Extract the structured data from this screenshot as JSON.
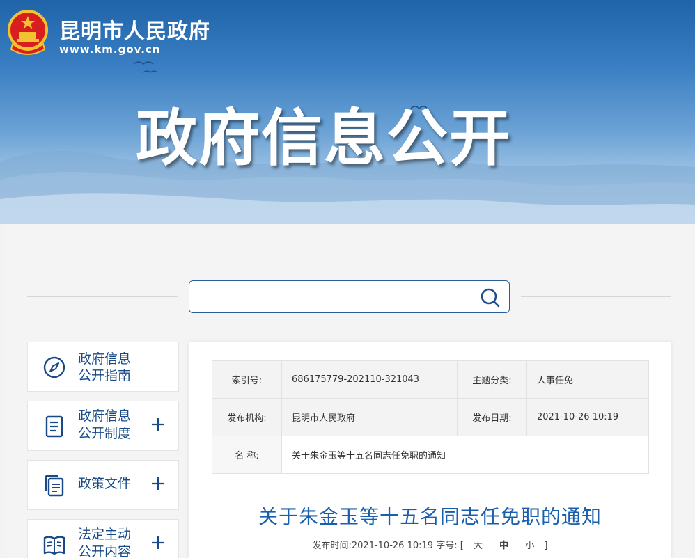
{
  "header": {
    "site_name": "昆明市人民政府",
    "site_url": "www.km.gov.cn",
    "banner_title": "政府信息公开"
  },
  "search": {
    "value": "",
    "placeholder": ""
  },
  "sidebar": {
    "items": [
      {
        "label_line1": "政府信息",
        "label_line2": "公开指南",
        "icon": "compass-icon",
        "expandable": false
      },
      {
        "label_line1": "政府信息",
        "label_line2": "公开制度",
        "icon": "document-icon",
        "expandable": true
      },
      {
        "label_line1": "政策文件",
        "label_line2": "",
        "icon": "files-icon",
        "expandable": true
      },
      {
        "label_line1": "法定主动",
        "label_line2": "公开内容",
        "icon": "book-icon",
        "expandable": true
      }
    ]
  },
  "meta": {
    "index_label": "索引号:",
    "index_value": "686175779-202110-321043",
    "category_label": "主题分类:",
    "category_value": "人事任免",
    "org_label": "发布机构:",
    "org_value": "昆明市人民政府",
    "date_label": "发布日期:",
    "date_value": "2021-10-26 10:19",
    "name_label": "名 称:",
    "name_value": "关于朱金玉等十五名同志任免职的通知"
  },
  "article": {
    "title": "关于朱金玉等十五名同志任免职的通知",
    "publish_label": "发布时间:",
    "publish_time": "2021-10-26 10:19",
    "fontsize_label": "字号:",
    "bracket_open": "[",
    "size_large": "大",
    "size_medium": "中",
    "size_small": "小",
    "bracket_close": "]"
  },
  "colors": {
    "accent": "#174a86",
    "title_blue": "#1a5fae",
    "search_border": "#2c5d99"
  }
}
